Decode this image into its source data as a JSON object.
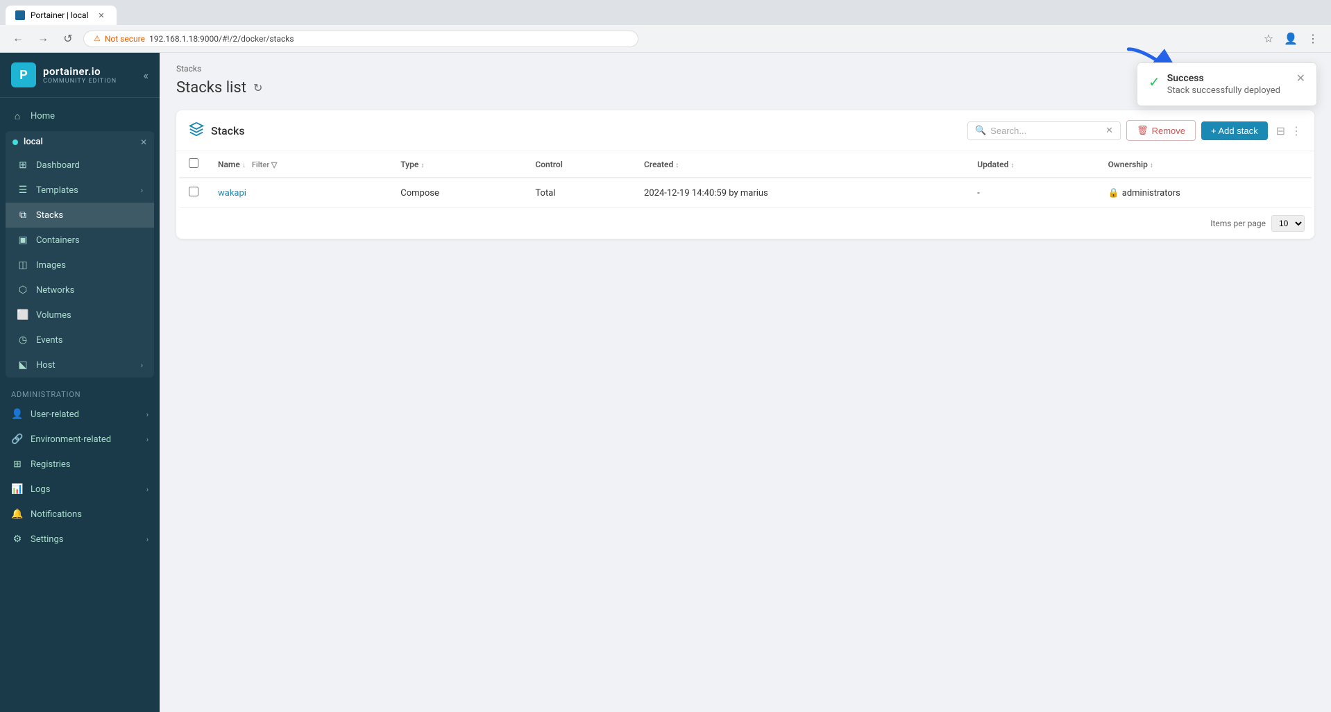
{
  "browser": {
    "tab_title": "Portainer | local",
    "address": "192.168.1.18:9000/#!/2/docker/stacks",
    "security_label": "Not secure",
    "nav_back": "←",
    "nav_forward": "→",
    "nav_reload": "↺"
  },
  "sidebar": {
    "logo_name": "portainer.io",
    "logo_edition": "COMMUNITY EDITION",
    "home_label": "Home",
    "local_label": "local",
    "nav_items": [
      {
        "id": "dashboard",
        "label": "Dashboard",
        "icon": "⊞"
      },
      {
        "id": "templates",
        "label": "Templates",
        "icon": "☰"
      },
      {
        "id": "stacks",
        "label": "Stacks",
        "icon": "⧉",
        "active": true
      },
      {
        "id": "containers",
        "label": "Containers",
        "icon": "▣"
      },
      {
        "id": "images",
        "label": "Images",
        "icon": "◫"
      },
      {
        "id": "networks",
        "label": "Networks",
        "icon": "⬡"
      },
      {
        "id": "volumes",
        "label": "Volumes",
        "icon": "⬜"
      },
      {
        "id": "events",
        "label": "Events",
        "icon": "◷"
      },
      {
        "id": "host",
        "label": "Host",
        "icon": "⬕",
        "has_chevron": true
      }
    ],
    "admin_section": "Administration",
    "admin_items": [
      {
        "id": "user-related",
        "label": "User-related",
        "icon": "👤",
        "has_chevron": true
      },
      {
        "id": "environment-related",
        "label": "Environment-related",
        "icon": "🔗",
        "has_chevron": true
      },
      {
        "id": "registries",
        "label": "Registries",
        "icon": "⊞"
      },
      {
        "id": "logs",
        "label": "Logs",
        "icon": "📊",
        "has_chevron": true
      },
      {
        "id": "notifications",
        "label": "Notifications",
        "icon": "🔔"
      },
      {
        "id": "settings",
        "label": "Settings",
        "icon": "⚙",
        "has_chevron": true
      }
    ]
  },
  "breadcrumb": "Stacks",
  "page_title": "Stacks list",
  "panel": {
    "title": "Stacks",
    "search_placeholder": "Search...",
    "remove_label": "Remove",
    "add_label": "+ Add stack",
    "items_per_page_label": "Items per page",
    "items_per_page_value": "10",
    "columns": [
      {
        "id": "name",
        "label": "Name"
      },
      {
        "id": "type",
        "label": "Type"
      },
      {
        "id": "control",
        "label": "Control"
      },
      {
        "id": "created",
        "label": "Created"
      },
      {
        "id": "updated",
        "label": "Updated"
      },
      {
        "id": "ownership",
        "label": "Ownership"
      }
    ],
    "rows": [
      {
        "name": "wakapi",
        "type": "Compose",
        "control": "Total",
        "created": "2024-12-19 14:40:59 by marius",
        "updated": "-",
        "ownership": "administrators"
      }
    ]
  },
  "notification": {
    "title": "Success",
    "message": "Stack successfully deployed",
    "type": "success"
  }
}
